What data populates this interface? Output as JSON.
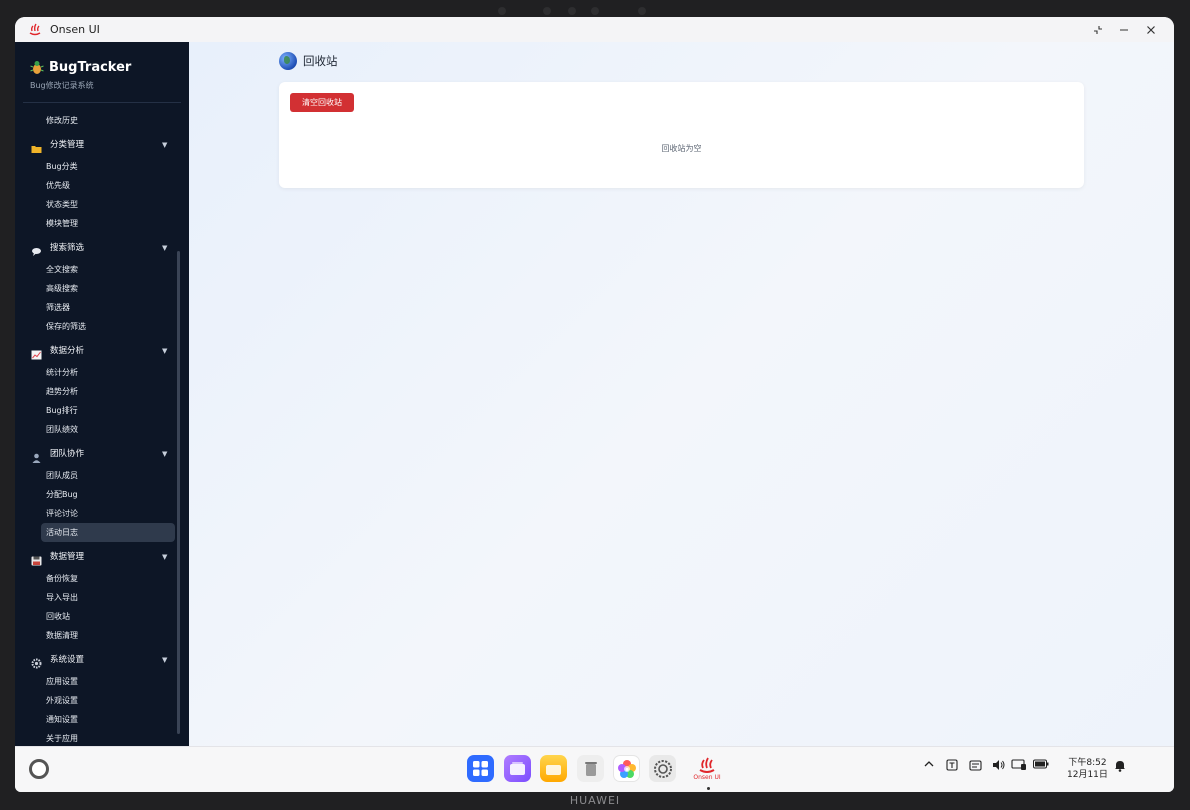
{
  "device": {
    "brand": "HUAWEI"
  },
  "window": {
    "title": "Onsen UI"
  },
  "sidebar": {
    "app_name": "BugTracker",
    "app_subtitle": "Bug修改记录系统",
    "items": [
      {
        "type": "item",
        "label": "修改历史"
      },
      {
        "type": "group",
        "label": "分类管理",
        "icon": "folder-icon"
      },
      {
        "type": "item",
        "label": "Bug分类"
      },
      {
        "type": "item",
        "label": "优先级"
      },
      {
        "type": "item",
        "label": "状态类型"
      },
      {
        "type": "item",
        "label": "模块管理"
      },
      {
        "type": "group",
        "label": "搜索筛选",
        "icon": "speech-bubble-icon"
      },
      {
        "type": "item",
        "label": "全文搜索"
      },
      {
        "type": "item",
        "label": "高级搜索"
      },
      {
        "type": "item",
        "label": "筛选器"
      },
      {
        "type": "item",
        "label": "保存的筛选"
      },
      {
        "type": "group",
        "label": "数据分析",
        "icon": "chart-icon"
      },
      {
        "type": "item",
        "label": "统计分析"
      },
      {
        "type": "item",
        "label": "趋势分析"
      },
      {
        "type": "item",
        "label": "Bug排行"
      },
      {
        "type": "item",
        "label": "团队绩效"
      },
      {
        "type": "group",
        "label": "团队协作",
        "icon": "user-icon"
      },
      {
        "type": "item",
        "label": "团队成员"
      },
      {
        "type": "item",
        "label": "分配Bug"
      },
      {
        "type": "item",
        "label": "评论讨论"
      },
      {
        "type": "item",
        "label": "活动日志",
        "active": true
      },
      {
        "type": "group",
        "label": "数据管理",
        "icon": "floppy-icon"
      },
      {
        "type": "item",
        "label": "备份恢复"
      },
      {
        "type": "item",
        "label": "导入导出"
      },
      {
        "type": "item",
        "label": "回收站"
      },
      {
        "type": "item",
        "label": "数据清理"
      },
      {
        "type": "group",
        "label": "系统设置",
        "icon": "gear-icon"
      },
      {
        "type": "item",
        "label": "应用设置"
      },
      {
        "type": "item",
        "label": "外观设置"
      },
      {
        "type": "item",
        "label": "通知设置"
      },
      {
        "type": "item",
        "label": "关于应用"
      }
    ]
  },
  "main": {
    "page_title": "回收站",
    "clear_button": "清空回收站",
    "empty_message": "回收站为空"
  },
  "taskbar": {
    "dock": [
      {
        "name": "app-gallery-icon",
        "color": "#2f6bff"
      },
      {
        "name": "multi-window-icon",
        "color": "#8e5bff"
      },
      {
        "name": "files-icon",
        "color": "#ffb300"
      },
      {
        "name": "trash-icon",
        "color": "#eaeaea"
      },
      {
        "name": "photos-icon",
        "color": "#ffffff"
      },
      {
        "name": "settings-icon",
        "color": "#e8e8e8"
      }
    ],
    "onsen_label": "Onsen UI",
    "time": "下午8:52",
    "date": "12月11日"
  }
}
